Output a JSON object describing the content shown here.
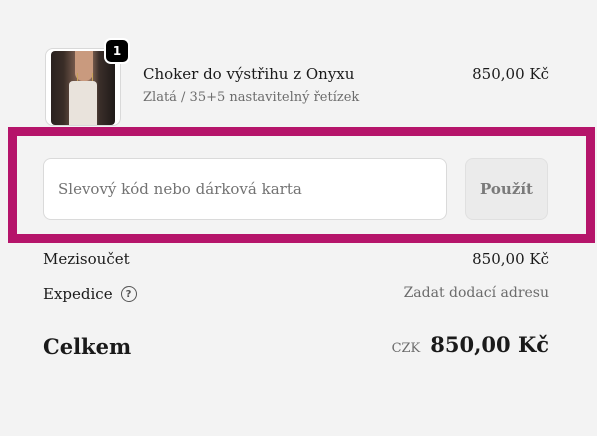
{
  "cart": {
    "item": {
      "quantity_badge": "1",
      "name": "Choker do výstřihu z Onyxu",
      "variant": "Zlatá / 35+5 nastavitelný řetízek",
      "price": "850,00 Kč",
      "image_icon": "product-photo"
    }
  },
  "discount": {
    "placeholder": "Slevový kód nebo dárková karta",
    "value": "",
    "apply_label": "Použít",
    "highlight_color": "#b5146a"
  },
  "summary": {
    "subtotal_label": "Mezisoučet",
    "subtotal_value": "850,00 Kč",
    "shipping_label": "Expedice",
    "shipping_help_icon": "question-circle-icon",
    "shipping_help_glyph": "?",
    "shipping_value": "Zadat dodací adresu",
    "total_label": "Celkem",
    "currency": "CZK",
    "total_value": "850,00 Kč"
  }
}
